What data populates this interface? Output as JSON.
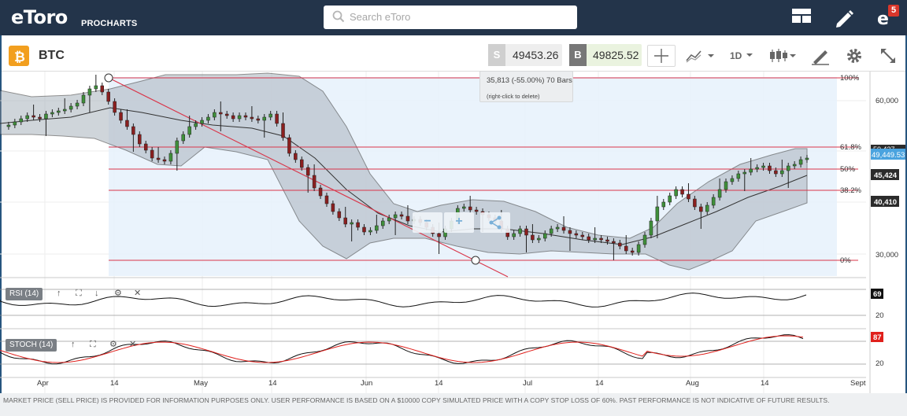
{
  "app": {
    "logo": "eToro",
    "logo_sub": "PROCHARTS",
    "search_placeholder": "Search eToro",
    "notification_count": "5"
  },
  "instrument": {
    "symbol": "BTC",
    "sell_key": "S",
    "sell_price": "49453.26",
    "buy_key": "B",
    "buy_price": "49825.52",
    "timeframe": "1D"
  },
  "tooltip": {
    "line1": "35,813 (-55.00%) 70 Bars",
    "line2": "(right-click to delete)"
  },
  "fib_levels": [
    {
      "label": "100%"
    },
    {
      "label": "61.8%"
    },
    {
      "label": "50%"
    },
    {
      "label": "38.2%"
    },
    {
      "label": "0%"
    }
  ],
  "price_axis": {
    "ticks": [
      "60,000",
      "30,000"
    ],
    "current_price": "49,449.53",
    "marker_a": "45,424",
    "marker_b": "40,410",
    "marker_top_partial": "50,437"
  },
  "rsi": {
    "label": "RSI (14)",
    "value": "69",
    "tick": "20"
  },
  "stoch": {
    "label": "STOCH (14)",
    "value": "87",
    "tick": "20"
  },
  "time_axis": [
    "Apr",
    "14",
    "May",
    "14",
    "Jun",
    "14",
    "Jul",
    "14",
    "Aug",
    "14",
    "Sept"
  ],
  "colors": {
    "topbar": "#23344a",
    "accent": "#27557f",
    "up": "#3f8f3a",
    "down": "#8a1f1f",
    "fib": "#d9364a",
    "band_fill": "#a9b3bd"
  },
  "footer": "MARKET PRICE (SELL PRICE) IS PROVIDED FOR INFORMATION PURPOSES ONLY. USER PERFORMANCE IS BASED ON A $10000 COPY SIMULATED PRICE WITH A COPY STOP LOSS OF 60%. PAST PERFORMANCE IS NOT INDICATIVE OF FUTURE RESULTS."
}
